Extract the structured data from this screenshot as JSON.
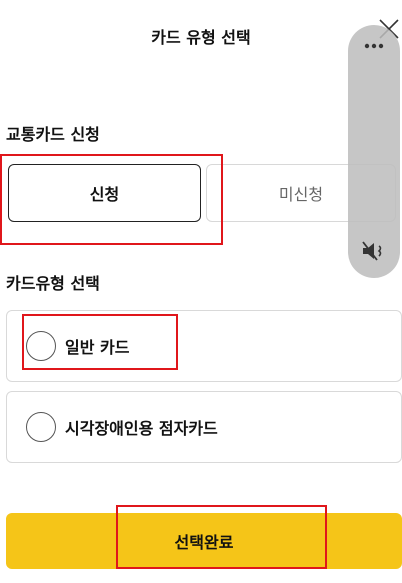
{
  "header": {
    "title": "카드 유형 선택"
  },
  "transit_section": {
    "label": "교통카드 신청",
    "options": [
      {
        "label": "신청",
        "selected": true
      },
      {
        "label": "미신청",
        "selected": false
      }
    ]
  },
  "cardtype_section": {
    "label": "카드유형 선택",
    "options": [
      {
        "label": "일반 카드",
        "selected": false
      },
      {
        "label": "시각장애인용 점자카드",
        "selected": false
      }
    ]
  },
  "footer": {
    "submit_label": "선택완료"
  },
  "colors": {
    "accent_yellow": "#f5c518",
    "highlight_red": "#e0161b"
  },
  "icons": {
    "close": "close-icon",
    "more": "more-icon",
    "mute": "mute-icon",
    "radio": "radio-icon"
  }
}
